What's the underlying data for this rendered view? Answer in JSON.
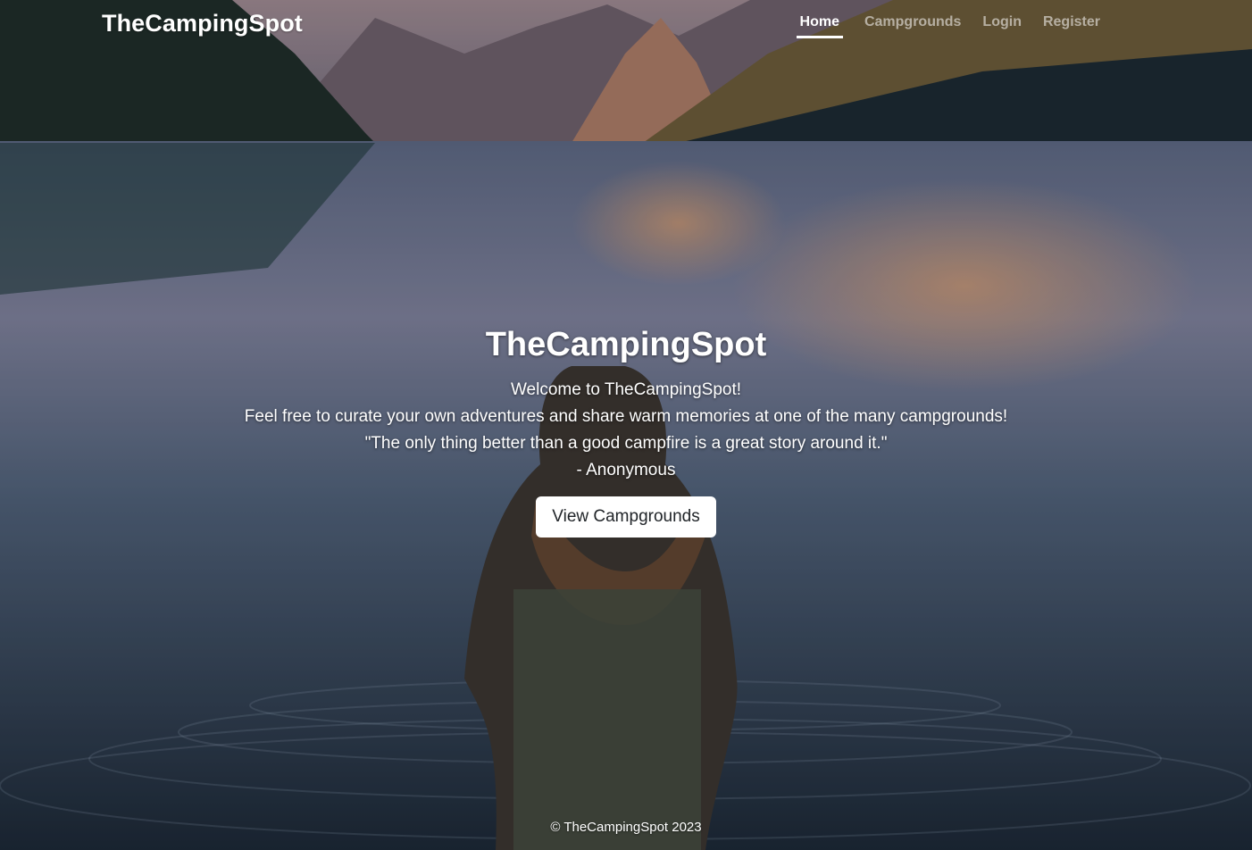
{
  "navbar": {
    "brand": "TheCampingSpot",
    "links": [
      {
        "label": "Home",
        "active": true
      },
      {
        "label": "Campgrounds",
        "active": false
      },
      {
        "label": "Login",
        "active": false
      },
      {
        "label": "Register",
        "active": false
      }
    ]
  },
  "hero": {
    "title": "TheCampingSpot",
    "lines": [
      "Welcome to TheCampingSpot!",
      "Feel free to curate your own adventures and share warm memories at one of the many campgrounds!",
      "\"The only thing better than a good campfire is a great story around it.\"",
      "- Anonymous"
    ],
    "button_label": "View Campgrounds"
  },
  "footer": {
    "text": "© TheCampingSpot 2023"
  },
  "colors": {
    "nav_active": "#ffffff",
    "nav_inactive": "#b5b0b8",
    "button_bg": "#ffffff",
    "button_text": "#212529"
  }
}
